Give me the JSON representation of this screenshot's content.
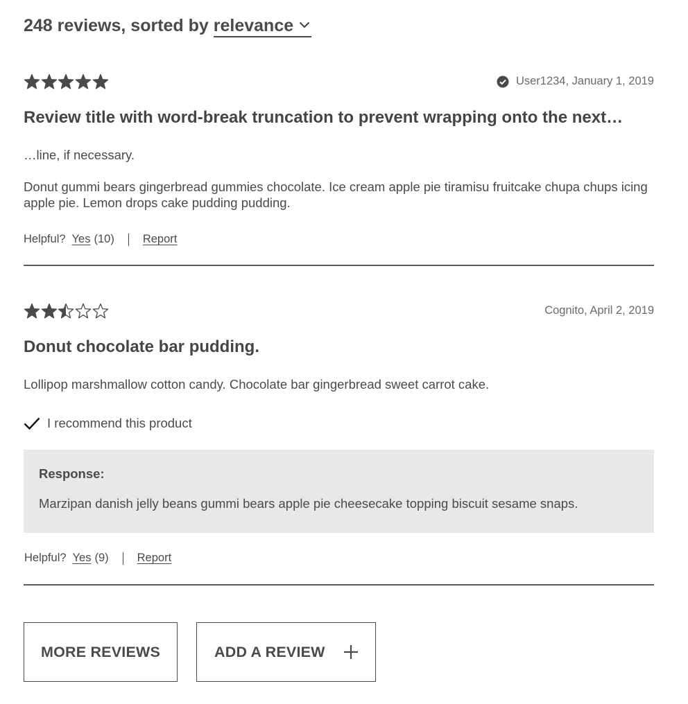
{
  "header": {
    "summary_prefix": "248 reviews, sorted by",
    "sort_value": "relevance"
  },
  "reviews": [
    {
      "rating": 5,
      "author_date": "User1234, January 1, 2019",
      "verified": true,
      "title": "Review title with word-break truncation to prevent wrapping onto the next…",
      "title_overflow": "…line, if necessary.",
      "body": "Donut gummi bears gingerbread gummies chocolate. Ice cream apple pie tiramisu fruitcake chupa chups icing apple pie. Lemon drops cake pudding pudding.",
      "helpful_label": "Helpful?",
      "yes_label": "Yes",
      "yes_count": "(10)",
      "report_label": "Report"
    },
    {
      "rating": 2.5,
      "author_date": "Cognito, April 2, 2019",
      "verified": false,
      "title": "Donut chocolate bar pudding.",
      "body": "Lollipop marshmallow cotton candy. Chocolate bar gingerbread sweet carrot cake.",
      "recommend_text": "I recommend this product",
      "response_label": "Response:",
      "response_text": "Marzipan danish jelly beans gummi bears apple pie cheesecake topping biscuit sesame snaps.",
      "helpful_label": "Helpful?",
      "yes_label": "Yes",
      "yes_count": "(9)",
      "report_label": "Report"
    }
  ],
  "buttons": {
    "more_reviews": "MORE REVIEWS",
    "add_review": "ADD A REVIEW"
  },
  "icons": {
    "star": "star-icon",
    "verified": "check-circle-icon",
    "recommend": "checkmark-icon",
    "add": "plus-icon",
    "sort": "chevron-down-icon"
  },
  "colors": {
    "text": "#4a4a4a",
    "response_bg": "#e8e8e8"
  }
}
